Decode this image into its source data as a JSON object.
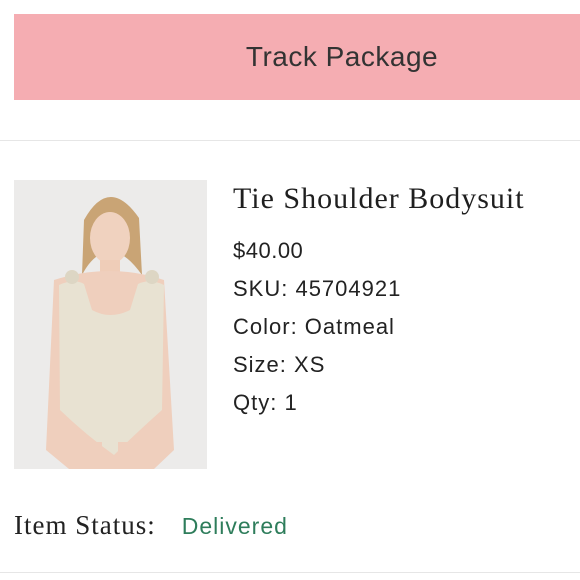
{
  "track_button": {
    "label": "Track Package",
    "color": "#f5adb2"
  },
  "product": {
    "title": "Tie Shoulder Bodysuit",
    "price": "$40.00",
    "sku": "SKU: 45704921",
    "color": "Color: Oatmeal",
    "size": "Size: XS",
    "qty": "Qty: 1",
    "image_icon": "product-photo"
  },
  "status": {
    "label": "Item Status:",
    "value": "Delivered",
    "value_color": "#2e7d5b"
  }
}
